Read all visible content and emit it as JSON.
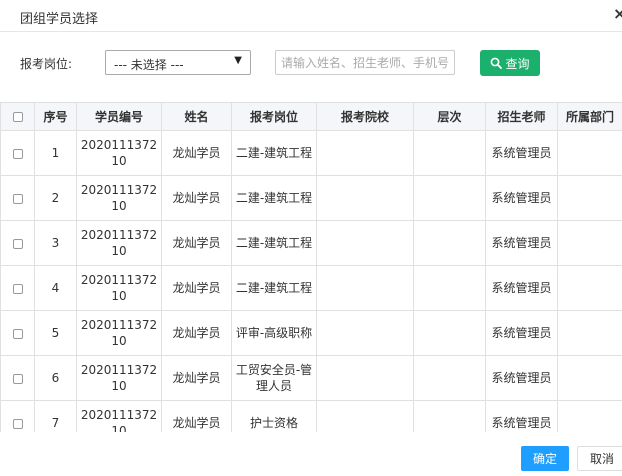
{
  "dialog": {
    "title": "团组学员选择",
    "close_icon": "close-icon"
  },
  "filter": {
    "label": "报考岗位:",
    "select_value": "--- 未选择 ---",
    "search_placeholder": "请输入姓名、招生老师、手机号码",
    "search_value": "",
    "query_label": "查询",
    "query_color": "#1cb06d"
  },
  "table": {
    "headers": [
      "",
      "序号",
      "学员编号",
      "姓名",
      "报考岗位",
      "报考院校",
      "层次",
      "招生老师",
      "所属部门"
    ],
    "rows": [
      {
        "index": "1",
        "student_id": "2020111372 10",
        "name": "龙灿学员",
        "position": "二建-建筑工程",
        "school": "",
        "level": "",
        "teacher": "系统管理员",
        "department": ""
      },
      {
        "index": "2",
        "student_id": "2020111372 10",
        "name": "龙灿学员",
        "position": "二建-建筑工程",
        "school": "",
        "level": "",
        "teacher": "系统管理员",
        "department": ""
      },
      {
        "index": "3",
        "student_id": "2020111372 10",
        "name": "龙灿学员",
        "position": "二建-建筑工程",
        "school": "",
        "level": "",
        "teacher": "系统管理员",
        "department": ""
      },
      {
        "index": "4",
        "student_id": "2020111372 10",
        "name": "龙灿学员",
        "position": "二建-建筑工程",
        "school": "",
        "level": "",
        "teacher": "系统管理员",
        "department": ""
      },
      {
        "index": "5",
        "student_id": "2020111372 10",
        "name": "龙灿学员",
        "position": "评审-高级职称",
        "school": "",
        "level": "",
        "teacher": "系统管理员",
        "department": ""
      },
      {
        "index": "6",
        "student_id": "2020111372 10",
        "name": "龙灿学员",
        "position": "工贸安全员-管理人员",
        "school": "",
        "level": "",
        "teacher": "系统管理员",
        "department": ""
      },
      {
        "index": "7",
        "student_id": "2020111372 10",
        "name": "龙灿学员",
        "position": "护士资格",
        "school": "",
        "level": "",
        "teacher": "系统管理员",
        "department": ""
      }
    ]
  },
  "footer": {
    "ok_label": "确定",
    "cancel_label": "取消",
    "ok_color": "#1e9fff"
  }
}
